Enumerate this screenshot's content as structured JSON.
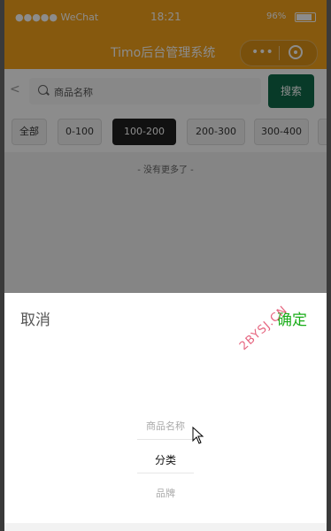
{
  "status_bar": {
    "carrier": "●●●●● WeChat",
    "time": "18:21",
    "battery": "96%"
  },
  "nav": {
    "title": "Timo后台管理系统",
    "menu_dots": "•••"
  },
  "search": {
    "placeholder": "商品名称",
    "button": "搜索",
    "back_glyph": "<"
  },
  "price_tabs": [
    "全部",
    "0-100",
    "100-200",
    "200-300",
    "300-400"
  ],
  "active_tab": "100-200",
  "no_more_text": "- 没有更多了 -",
  "picker": {
    "cancel": "取消",
    "confirm": "确定",
    "options": [
      "商品名称",
      "分类",
      "品牌"
    ],
    "selected": "分类"
  },
  "watermark": "2BYSJ.CN",
  "colors": {
    "nav_bg": "#f5a31a",
    "search_button": "#0f6b4a",
    "confirm": "#1aad19",
    "active_tab": "#1f1f1f"
  }
}
